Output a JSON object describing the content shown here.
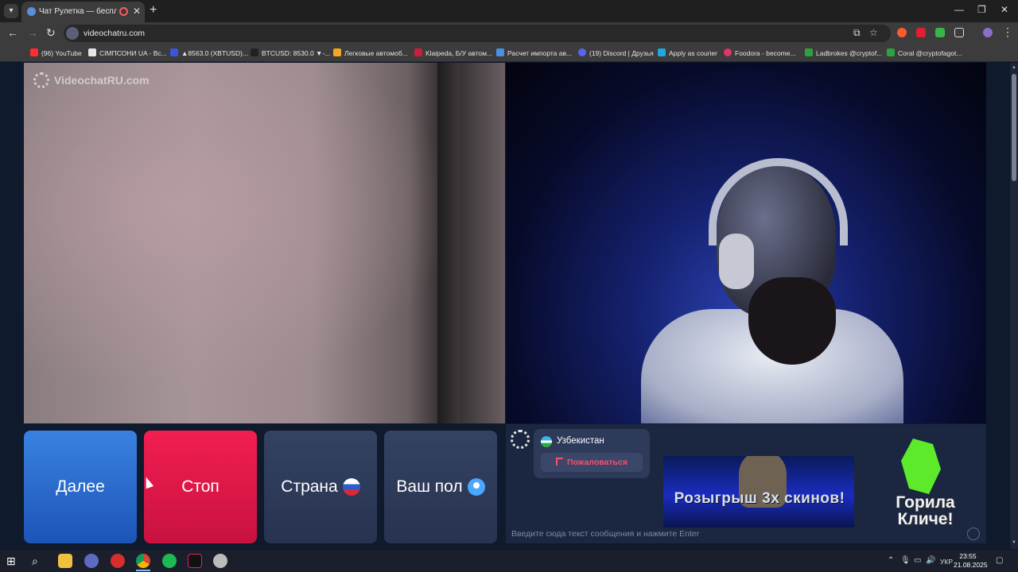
{
  "browser": {
    "tab_title": "Чат Рулетка — бесплатный",
    "url": "videochatru.com",
    "bookmarks": [
      {
        "label": "(96) YouTube",
        "color": "#ff2d2d"
      },
      {
        "label": "СІМПСОНИ UA - Вс...",
        "color": "#e6e6e6"
      },
      {
        "label": "▲8563.0 (XBTUSD)...",
        "color": "#3a55e0"
      },
      {
        "label": "BTCUSD: 8530.0 ▼-...",
        "color": "#222222"
      },
      {
        "label": "Легковые автомоб...",
        "color": "#f5a623"
      },
      {
        "label": "Klaipeda, Б/У автом...",
        "color": "#c8203c"
      },
      {
        "label": "Расчет импорта ав...",
        "color": "#4a90e2"
      },
      {
        "label": "(19) Discord | Друзья",
        "color": "#5865f2"
      },
      {
        "label": "Apply as courier",
        "color": "#1fa8e0"
      },
      {
        "label": "Foodora - become...",
        "color": "#e0346a"
      },
      {
        "label": "Ladbrokes @cryptof...",
        "color": "#2ea043"
      },
      {
        "label": "Coral @cryptofagot...",
        "color": "#2ea043"
      }
    ]
  },
  "page": {
    "logo_text": "VideochatRU.com",
    "buttons": {
      "next": "Далее",
      "stop": "Стоп",
      "country": "Страна",
      "gender": "Ваш пол"
    },
    "chat": {
      "country": "Узбекистан",
      "report": "Пожаловаться",
      "input_placeholder": "Введите сюда текст сообщения и нажмите Enter"
    },
    "ads": {
      "ad1_text": "Розыгрыш 3х скинов!",
      "ad2_text": "Горила Кличе!"
    }
  },
  "taskbar": {
    "lang": "УКР",
    "time": "23:55",
    "date": "21.08.2025"
  }
}
